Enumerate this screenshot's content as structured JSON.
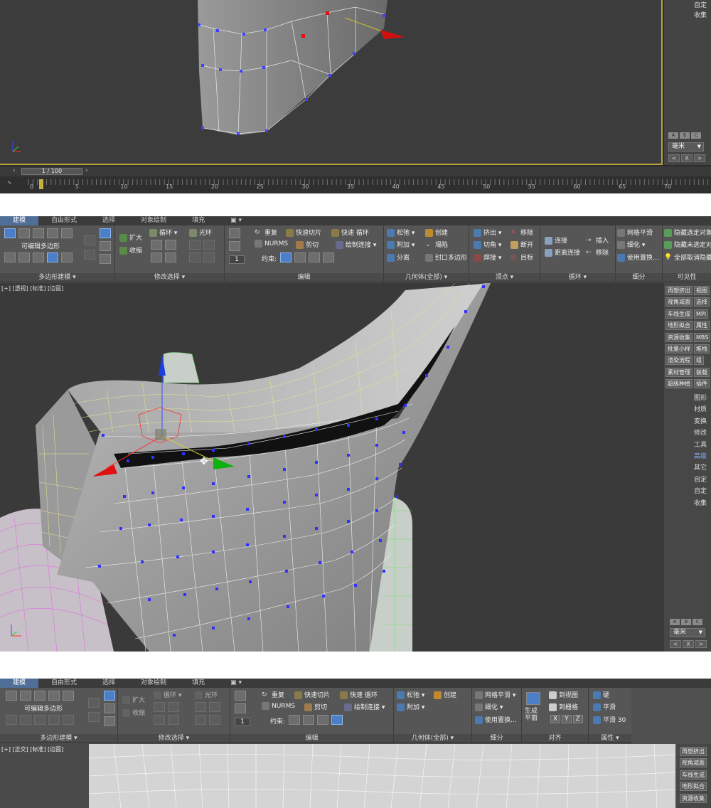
{
  "frame1": {
    "command_panel_labels": [
      "自定",
      "收集"
    ],
    "axis_buttons": [
      "A",
      "B",
      "C"
    ],
    "unit": "毫米",
    "unit_buttons": [
      "<",
      "X",
      ">"
    ],
    "timeslider": "1 / 100",
    "timeline_ticks": [
      "0",
      "5",
      "10",
      "15",
      "20",
      "25",
      "30",
      "35",
      "40",
      "45",
      "50",
      "55",
      "60",
      "65",
      "70"
    ]
  },
  "frame2": {
    "tabs": [
      "建模",
      "自由形式",
      "选择",
      "对象绘制",
      "填充"
    ],
    "groups": {
      "polygon_modeling": {
        "label": "可编辑多边形",
        "name": "多边形建模 ▾"
      },
      "modify_selection": {
        "name": "修改选择 ▾",
        "items": [
          "扩大",
          "收缩",
          "循环",
          "光环"
        ]
      },
      "edit": {
        "name": "编辑",
        "items": [
          "重复",
          "快速切片",
          "快速 循环",
          "NURMS",
          "剪切",
          "绘制连接"
        ],
        "constraint_label": "约束:",
        "spinner_value": "1"
      },
      "geometry": {
        "name": "几何体(全部) ▾",
        "items": [
          "松弛",
          "创建",
          "附加",
          "塌陷",
          "分离",
          "封口多边形"
        ]
      },
      "vertices": {
        "name": "顶点 ▾",
        "items": [
          "挤出",
          "移除",
          "切角",
          "断开",
          "焊接",
          "目标"
        ]
      },
      "loops": {
        "name": "循环 ▾",
        "items": [
          "连接",
          "插入",
          "距离连接",
          "移除"
        ]
      },
      "subdivision": {
        "name": "细分",
        "items": [
          "网格平滑",
          "细化",
          "使用置换..."
        ]
      },
      "visibility": {
        "name": "可见性",
        "items": [
          "隐藏选定对象",
          "隐藏未选定对",
          "全部取消隐藏"
        ]
      }
    },
    "viewport_label": "[+] [透视] [标准] [边面]",
    "command_panel": [
      [
        "再塑挤出",
        "视图"
      ],
      [
        "视角减面",
        "选择"
      ],
      [
        "车线生成",
        "MPI"
      ],
      [
        "地形拟合",
        "属性"
      ],
      [
        "资源收集",
        "MBS"
      ],
      [
        "批量小样",
        "堆栈"
      ],
      [
        "渲染流程",
        "组"
      ],
      [
        "素材管理",
        "装载"
      ],
      [
        "超级种植",
        "插件"
      ]
    ],
    "command_singles": [
      "图形",
      "材质",
      "变换",
      "修改",
      "工具",
      "高级",
      "其它",
      "自定",
      "自定",
      "收集"
    ],
    "highlighted_single": "高级",
    "axis_buttons": [
      "A",
      "B",
      "C"
    ],
    "unit": "毫米",
    "unit_buttons": [
      "<",
      "X",
      ">"
    ]
  },
  "frame3": {
    "tabs": [
      "建模",
      "自由形式",
      "选择",
      "对象绘制",
      "填充"
    ],
    "groups": {
      "polygon_modeling": {
        "label": "可编辑多边形",
        "name": "多边形建模 ▾"
      },
      "modify_selection": {
        "name": "修改选择 ▾",
        "items": [
          "扩大",
          "收缩",
          "循环",
          "光环"
        ]
      },
      "edit": {
        "name": "编辑",
        "items": [
          "重复",
          "快速切片",
          "快速 循环",
          "NURMS",
          "剪切",
          "绘制连接"
        ],
        "constraint_label": "约束:",
        "spinner_value": "1"
      },
      "geometry": {
        "name": "几何体(全部) ▾",
        "items": [
          "松弛",
          "创建",
          "附加"
        ]
      },
      "subdivision": {
        "name": "细分",
        "items": [
          "网格平滑",
          "细化",
          "使用置换..."
        ]
      },
      "align": {
        "name": "对齐",
        "items": [
          "生成\n平面",
          "到视图",
          "到栅格"
        ],
        "xyz": [
          "X",
          "Y",
          "Z"
        ]
      },
      "properties": {
        "name": "属性 ▾",
        "items": [
          "硬",
          "平滑",
          "平滑 30"
        ]
      }
    },
    "viewport_label": "[+] [正交] [标准] [边面]",
    "command_panel": [
      "再塑挤出",
      "视角减面",
      "车线生成",
      "地形拟合",
      "资源收集"
    ]
  }
}
